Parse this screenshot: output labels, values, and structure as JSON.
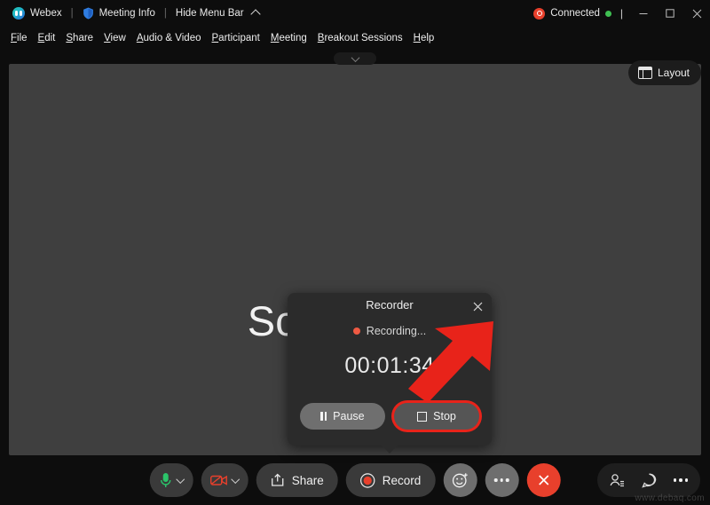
{
  "titlebar": {
    "app_name": "Webex",
    "meeting_info": "Meeting Info",
    "hide_menu_bar": "Hide Menu Bar",
    "separator": "|",
    "connection_status": "Connected",
    "divider": "|",
    "minimize_tooltip": "Minimize",
    "maximize_tooltip": "Maximize",
    "close_tooltip": "Close",
    "accent_recording": "#e8402c",
    "accent_online": "#3fbf52"
  },
  "menubar": {
    "items": [
      {
        "label": "File",
        "accel": "F",
        "rest": "ile"
      },
      {
        "label": "Edit",
        "accel": "E",
        "rest": "dit"
      },
      {
        "label": "Share",
        "accel": "S",
        "rest": "hare"
      },
      {
        "label": "View",
        "accel": "V",
        "rest": "iew"
      },
      {
        "label": "Audio & Video",
        "accel": "A",
        "rest": "udio & Video"
      },
      {
        "label": "Participant",
        "accel": "P",
        "rest": "articipant"
      },
      {
        "label": "Meeting",
        "accel": "M",
        "rest": "eeting"
      },
      {
        "label": "Breakout Sessions",
        "accel": "B",
        "rest": "reakout Sessions"
      },
      {
        "label": "Help",
        "accel": "H",
        "rest": "elp"
      }
    ]
  },
  "stage": {
    "participant_name": "Scott Smith",
    "background_color": "#3f3f3f",
    "layout_button_label": "Layout",
    "collapse_icon": "chevron-down-icon"
  },
  "recorder": {
    "title": "Recorder",
    "status_text": "Recording...",
    "status_dot_color": "#ef5a43",
    "timer": "00:01:34",
    "pause_label": "Pause",
    "stop_label": "Stop",
    "close_icon": "close-icon",
    "highlight_color": "#e8231a"
  },
  "annotation": {
    "arrow_color": "#e8231a",
    "arrow_target": "stop-button"
  },
  "controlbar": {
    "mic": {
      "icon": "microphone-icon",
      "state": "unmuted",
      "color": "#2bc46a",
      "chevron": "chevron-down-icon"
    },
    "video": {
      "icon": "camera-off-icon",
      "state": "off",
      "color": "#e8402c",
      "chevron": "chevron-down-icon"
    },
    "share_label": "Share",
    "record_label": "Record",
    "record_dot_color": "#e8402c",
    "reactions_icon": "reaction-smiley-icon",
    "more_icon": "more-options-icon",
    "leave_icon": "leave-meeting-icon",
    "leave_color": "#e8402c",
    "participants_icon": "participants-icon",
    "chat_icon": "chat-bubble-icon",
    "more_panel_icon": "more-panel-icon"
  },
  "watermark": {
    "text": "www.debaq.com"
  }
}
